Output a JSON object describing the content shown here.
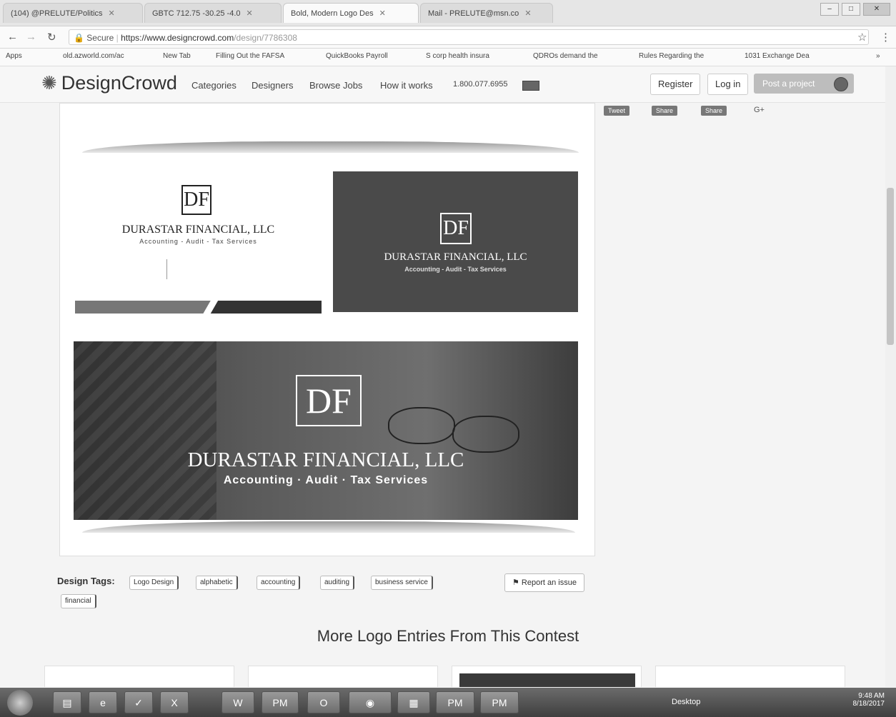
{
  "browser": {
    "tabs": [
      {
        "label": "(104) @PRELUTE/Politics",
        "active": false
      },
      {
        "label": "GBTC 712.75 -30.25 -4.0",
        "active": false
      },
      {
        "label": "Bold, Modern Logo Des",
        "active": true
      },
      {
        "label": "Mail - PRELUTE@msn.co",
        "active": false
      }
    ],
    "secure_label": "Secure",
    "url_host": "https://www.designcrowd.com",
    "url_path": "/design/7786308",
    "bookmarks": [
      "Apps",
      "old.azworld.com/ac",
      "New Tab",
      "Filling Out the FAFSA",
      "QuickBooks Payroll",
      "S corp health insura",
      "QDROs demand the",
      "Rules Regarding the",
      "1031 Exchange Dea"
    ]
  },
  "site": {
    "logo": "DesignCrowd",
    "nav": [
      "Categories",
      "Designers",
      "Browse Jobs",
      "How it works"
    ],
    "phone": "1.800.077.6955",
    "register": "Register",
    "login": "Log in",
    "post_project": "Post a project"
  },
  "social": [
    "Tweet",
    "Share",
    "Share",
    "G+"
  ],
  "design": {
    "monogram": "DF",
    "company": "DURASTAR FINANCIAL, LLC",
    "tagline": "Accounting - Audit - Tax Services",
    "banner_tagline": "Accounting · Audit · Tax Services"
  },
  "tags": {
    "label": "Design Tags:",
    "items": [
      "Logo Design",
      "alphabetic",
      "accounting",
      "auditing",
      "business service",
      "financial"
    ],
    "report": "Report an issue"
  },
  "more_heading": "More Logo Entries From This Contest",
  "taskbar": {
    "desktop": "Desktop",
    "time": "9:48 AM",
    "date": "8/18/2017",
    "pm1": "PM",
    "pm2": "PM",
    "pm3": "PM"
  }
}
